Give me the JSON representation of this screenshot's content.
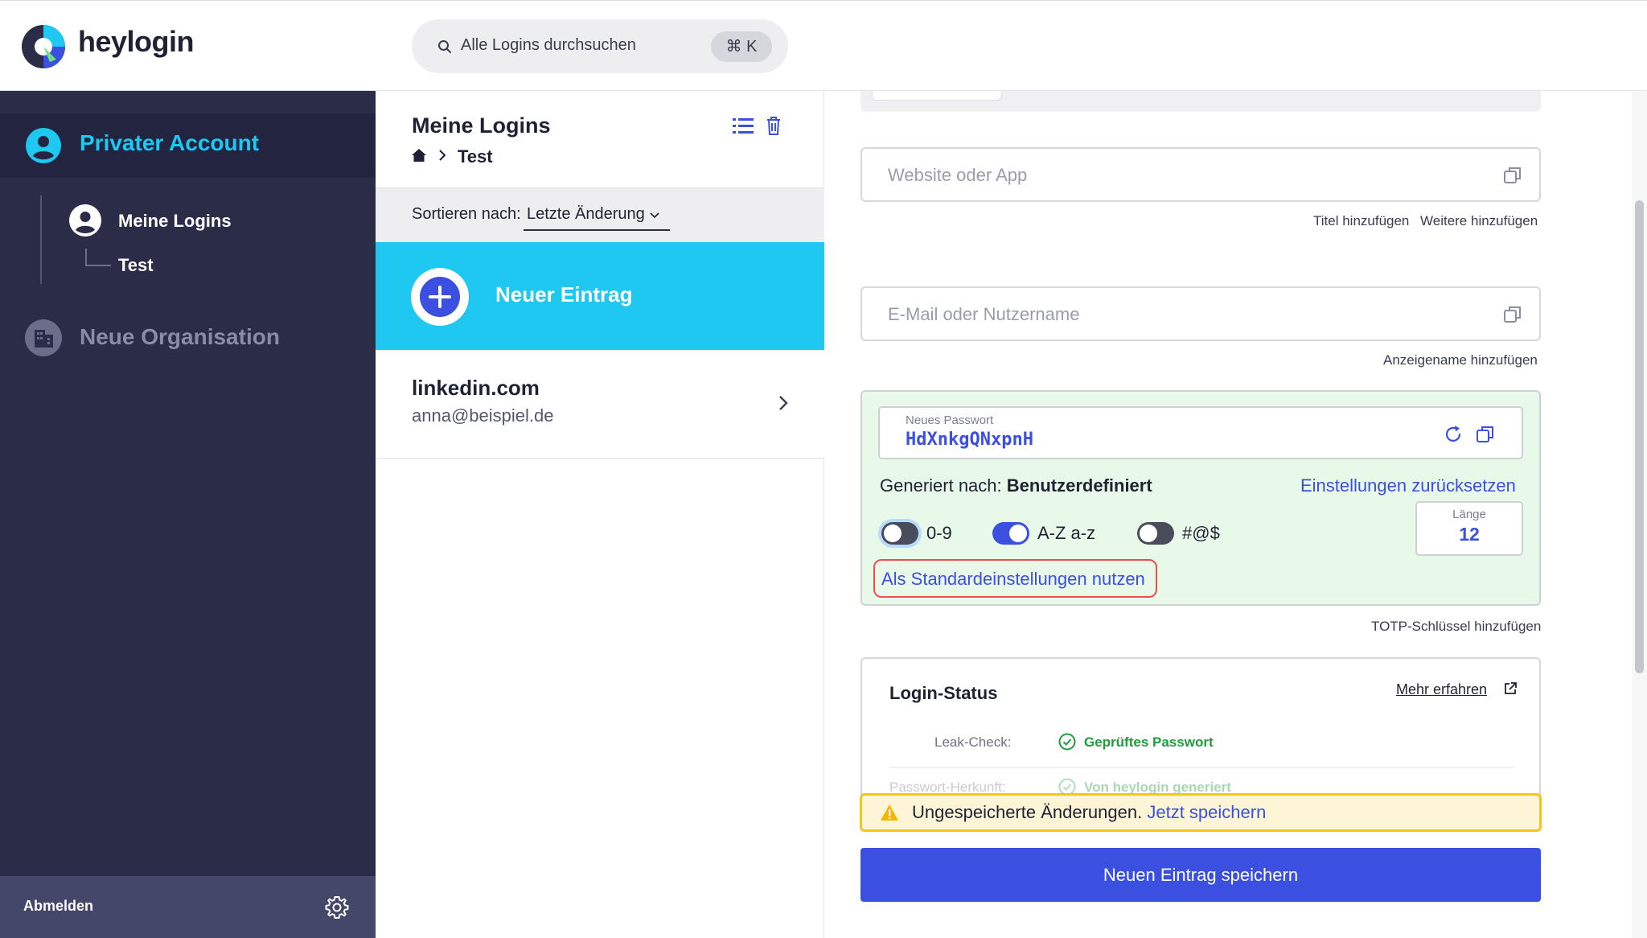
{
  "header": {
    "brand": "heylogin",
    "search_placeholder": "Alle Logins durchsuchen",
    "search_shortcut": "⌘ K"
  },
  "sidebar": {
    "account_label": "Privater Account",
    "tree": [
      {
        "label": "Meine Logins"
      },
      {
        "label": "Test"
      }
    ],
    "organization_label": "Neue Organisation",
    "logout_label": "Abmelden"
  },
  "list_panel": {
    "title": "Meine Logins",
    "breadcrumb_current": "Test",
    "sort_label": "Sortieren nach:",
    "sort_value": "Letzte Änderung",
    "new_entry_label": "Neuer Eintrag",
    "entries": [
      {
        "title": "linkedin.com",
        "subtitle": "anna@beispiel.de"
      }
    ]
  },
  "form": {
    "website_placeholder": "Website oder App",
    "add_title": "Titel hinzufügen",
    "add_more": "Weitere hinzufügen",
    "username_placeholder": "E-Mail oder Nutzername",
    "add_display_name": "Anzeigename hinzufügen",
    "password": {
      "label": "Neues Passwort",
      "value": "HdXnkgQNxpnH",
      "generated_by_prefix": "Generiert nach:",
      "generated_by_value": "Benutzerdefiniert",
      "reset_link": "Einstellungen zurücksetzen",
      "options": [
        {
          "label": "0-9",
          "enabled": false
        },
        {
          "label": "A-Z a-z",
          "enabled": true
        },
        {
          "label": "#@$",
          "enabled": false
        }
      ],
      "length_label": "Länge",
      "length_value": "12",
      "use_default_label": "Als Standardeinstellungen nutzen"
    },
    "add_totp": "TOTP-Schlüssel hinzufügen",
    "login_status": {
      "title": "Login-Status",
      "learn_more": "Mehr erfahren",
      "leak_check_label": "Leak-Check:",
      "leak_check_value": "Geprüftes Passwort",
      "origin_label": "Passwort-Herkunft:",
      "origin_value": "Von heylogin generiert"
    },
    "unsaved_text": "Ungespeicherte Änderungen.",
    "save_now_link": "Jetzt speichern",
    "save_button": "Neuen Eintrag speichern"
  },
  "colors": {
    "sidebar_bg": "#2a2c48",
    "accent_cyan": "#1ec8f0",
    "primary_blue": "#3b4fe0",
    "success_green": "#1e9b3a",
    "warning_yellow": "#f5c518",
    "highlight_red": "#e85050"
  },
  "icons": [
    "heylogin-logo-icon",
    "search-icon",
    "user-circle-icon",
    "building-icon",
    "gear-icon",
    "list-icon",
    "trash-icon",
    "home-icon",
    "chevron-right-icon",
    "chevron-down-icon",
    "plus-icon",
    "copy-icon",
    "refresh-icon",
    "external-link-icon",
    "check-circle-icon",
    "warning-icon"
  ]
}
